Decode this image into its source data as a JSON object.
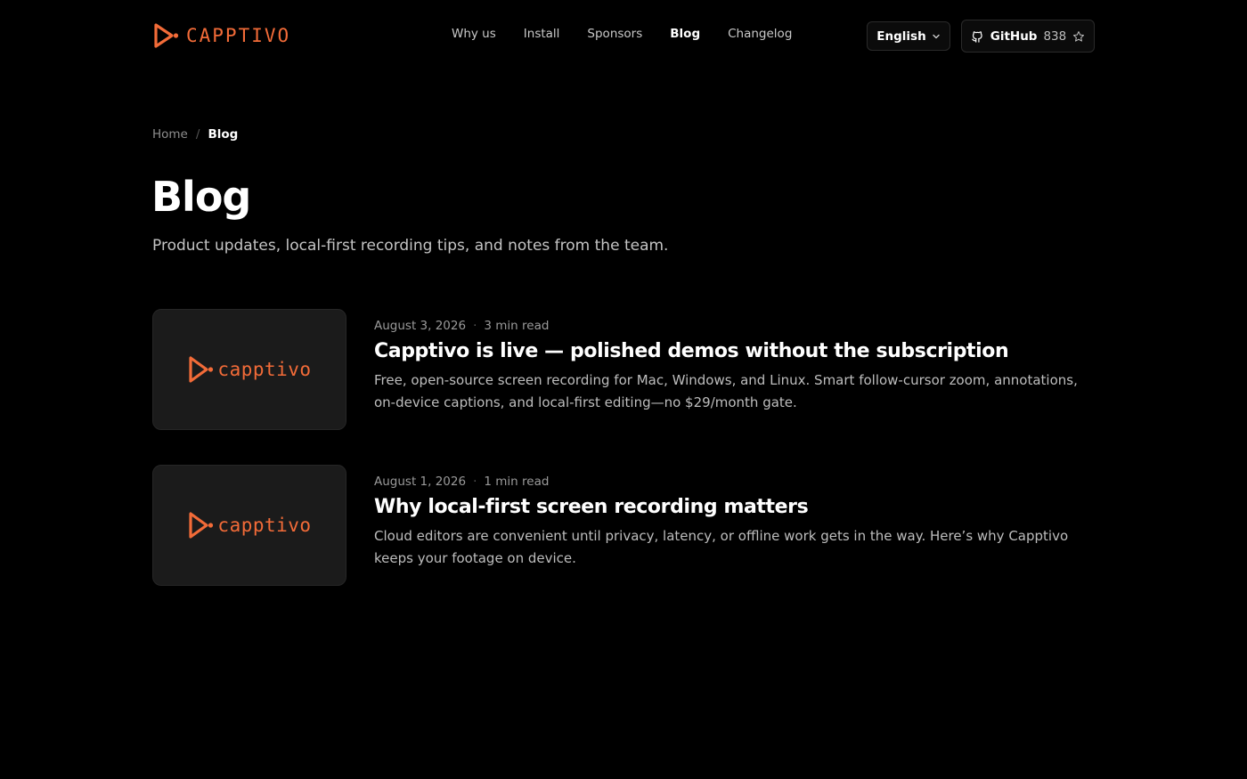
{
  "brand": {
    "name": "CAPPTIVO",
    "accent_color": "#f26b38",
    "logo_icon": "play-triangle-icon"
  },
  "nav": {
    "items": [
      {
        "label": "Why us"
      },
      {
        "label": "Install"
      },
      {
        "label": "Sponsors"
      },
      {
        "label": "Blog",
        "active": true
      },
      {
        "label": "Changelog"
      }
    ]
  },
  "language": {
    "selected": "English",
    "icon": "chevron-down-icon"
  },
  "github": {
    "label": "GitHub",
    "stars": "838",
    "icons": [
      "github-icon",
      "star-icon"
    ]
  },
  "breadcrumb": {
    "home": "Home",
    "separator": "/",
    "current": "Blog"
  },
  "page": {
    "title": "Blog",
    "subtitle": "Product updates, local-first recording tips, and notes from the team."
  },
  "posts": [
    {
      "thumb_text": "capptivo",
      "date": "August 3, 2026",
      "separator": "·",
      "read_time": "3 min read",
      "title": "Capptivo is live — polished demos without the subscription",
      "excerpt": "Free, open-source screen recording for Mac, Windows, and Linux. Smart follow-cursor zoom, annotations, on-device captions, and local-first editing—no $29/month gate."
    },
    {
      "thumb_text": "capptivo",
      "date": "August 1, 2026",
      "separator": "·",
      "read_time": "1 min read",
      "title": "Why local-first screen recording matters",
      "excerpt": "Cloud editors are convenient until privacy, latency, or offline work gets in the way. Here’s why Capptivo keeps your footage on device."
    }
  ]
}
